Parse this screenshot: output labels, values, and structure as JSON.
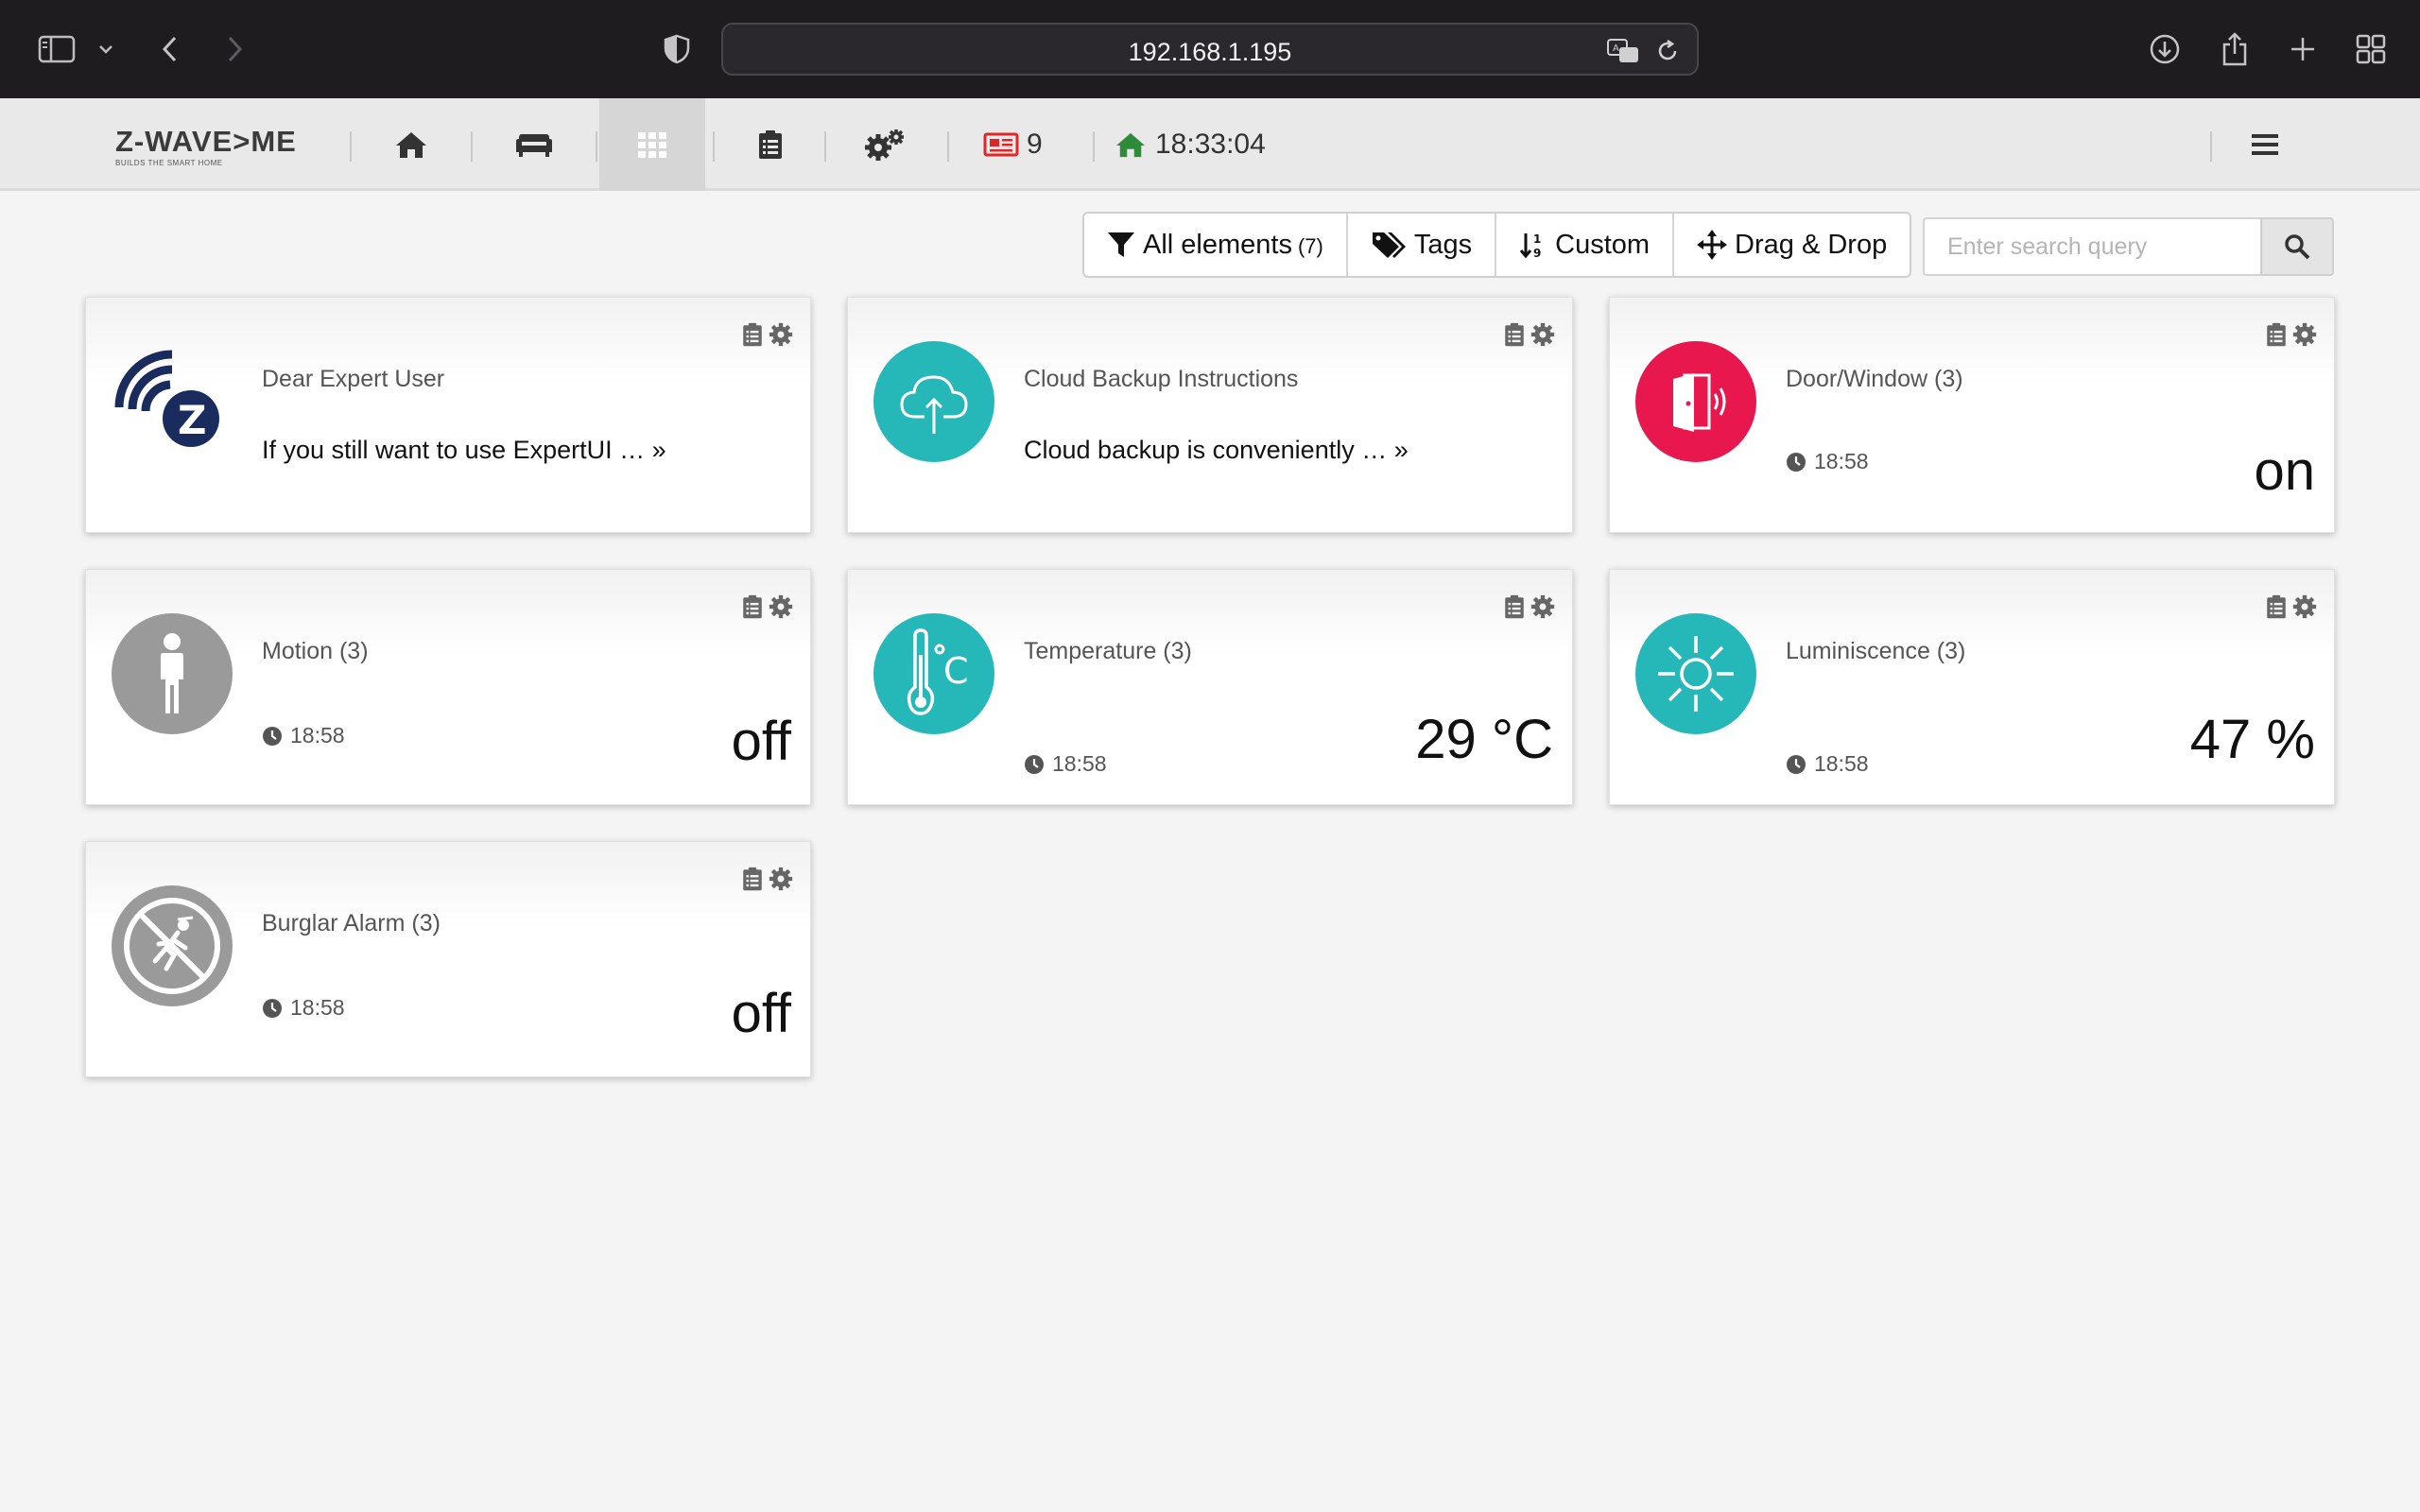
{
  "browser": {
    "url": "192.168.1.195"
  },
  "header": {
    "logo_text": "Z-WAVE>ME",
    "logo_tagline": "BUILDS THE SMART HOME",
    "notifications_count": "9",
    "time": "18:33:04"
  },
  "toolbar": {
    "all_elements_label": "All elements",
    "all_elements_count": "(7)",
    "tags_label": "Tags",
    "custom_label": "Custom",
    "drag_drop_label": "Drag & Drop",
    "search_placeholder": "Enter search query"
  },
  "cards": [
    {
      "title": "Dear Expert User",
      "description": "If you still want to use ExpertUI … »",
      "icon": "z-wave-logo-icon"
    },
    {
      "title": "Cloud Backup Instructions",
      "description": "Cloud backup is conveniently … »",
      "icon": "cloud-upload-icon",
      "icon_color": "#26b8b8"
    },
    {
      "title": "Door/Window (3)",
      "time": "18:58",
      "level": "on",
      "icon": "door-open-icon",
      "icon_color": "#e8174d"
    },
    {
      "title": "Motion (3)",
      "time": "18:58",
      "level": "off",
      "icon": "person-icon",
      "icon_color": "#9a9a9a"
    },
    {
      "title": "Temperature (3)",
      "time": "18:58",
      "level": "29 °C",
      "icon": "thermometer-icon",
      "icon_color": "#26b8b8"
    },
    {
      "title": "Luminiscence (3)",
      "time": "18:58",
      "level": "47 %",
      "icon": "sun-icon",
      "icon_color": "#26b8b8"
    },
    {
      "title": "Burglar Alarm (3)",
      "time": "18:58",
      "level": "off",
      "icon": "burglar-alarm-icon",
      "icon_color": "#9a9a9a"
    }
  ],
  "colors": {
    "accent_teal": "#26b8b8",
    "accent_red": "#e8174d",
    "notification_red": "#e02626",
    "home_green": "#2e8b3a"
  }
}
